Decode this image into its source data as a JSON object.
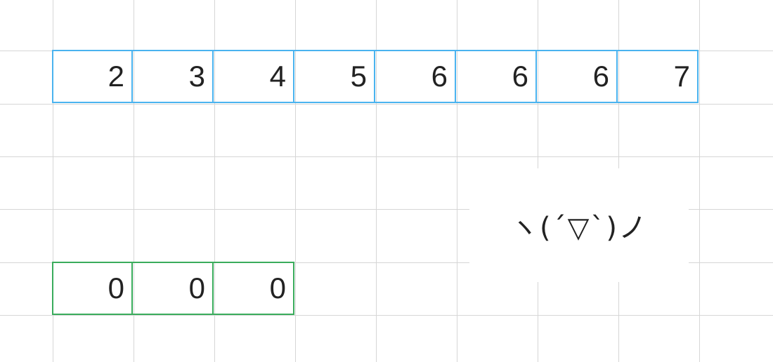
{
  "arrays": [
    {
      "id": "blue-array",
      "border_color": "#4ab3ef",
      "values": [
        "2",
        "3",
        "4",
        "5",
        "6",
        "6",
        "6",
        "7"
      ]
    },
    {
      "id": "green-array",
      "border_color": "#3aac5c",
      "values": [
        "0",
        "0",
        "0"
      ]
    }
  ],
  "kaomoji": "ヽ(ˊ▽ˋ)ノ",
  "grid_color": "#d6d6d6"
}
